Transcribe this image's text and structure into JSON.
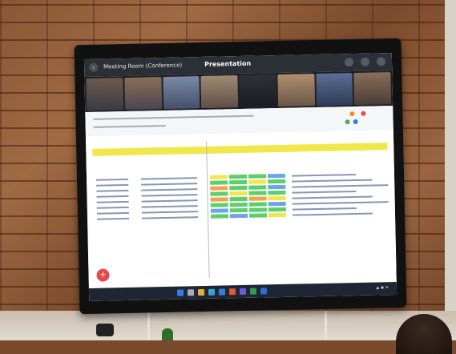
{
  "meeting": {
    "title": "Meeting Room (Conference)",
    "center_label": "Presentation",
    "back_icon": "arrow-left-icon",
    "toolbar_icons": [
      "mic-icon",
      "camera-icon",
      "more-icon"
    ]
  },
  "tv": {
    "brand": ""
  },
  "sheet": {
    "header_color": "#efe84a",
    "cell_colors": {
      "green": "#5ccf6b",
      "yellow": "#efe84a",
      "orange": "#f2a44a",
      "blue": "#6da6e6"
    }
  },
  "fab": {
    "icon": "plus-icon",
    "color": "#e64a4a"
  },
  "taskbar": {
    "icons": [
      "start-icon",
      "search-icon",
      "files-icon",
      "browser-icon",
      "mail-icon",
      "chrome-icon",
      "teams-icon",
      "excel-icon",
      "word-icon"
    ]
  }
}
